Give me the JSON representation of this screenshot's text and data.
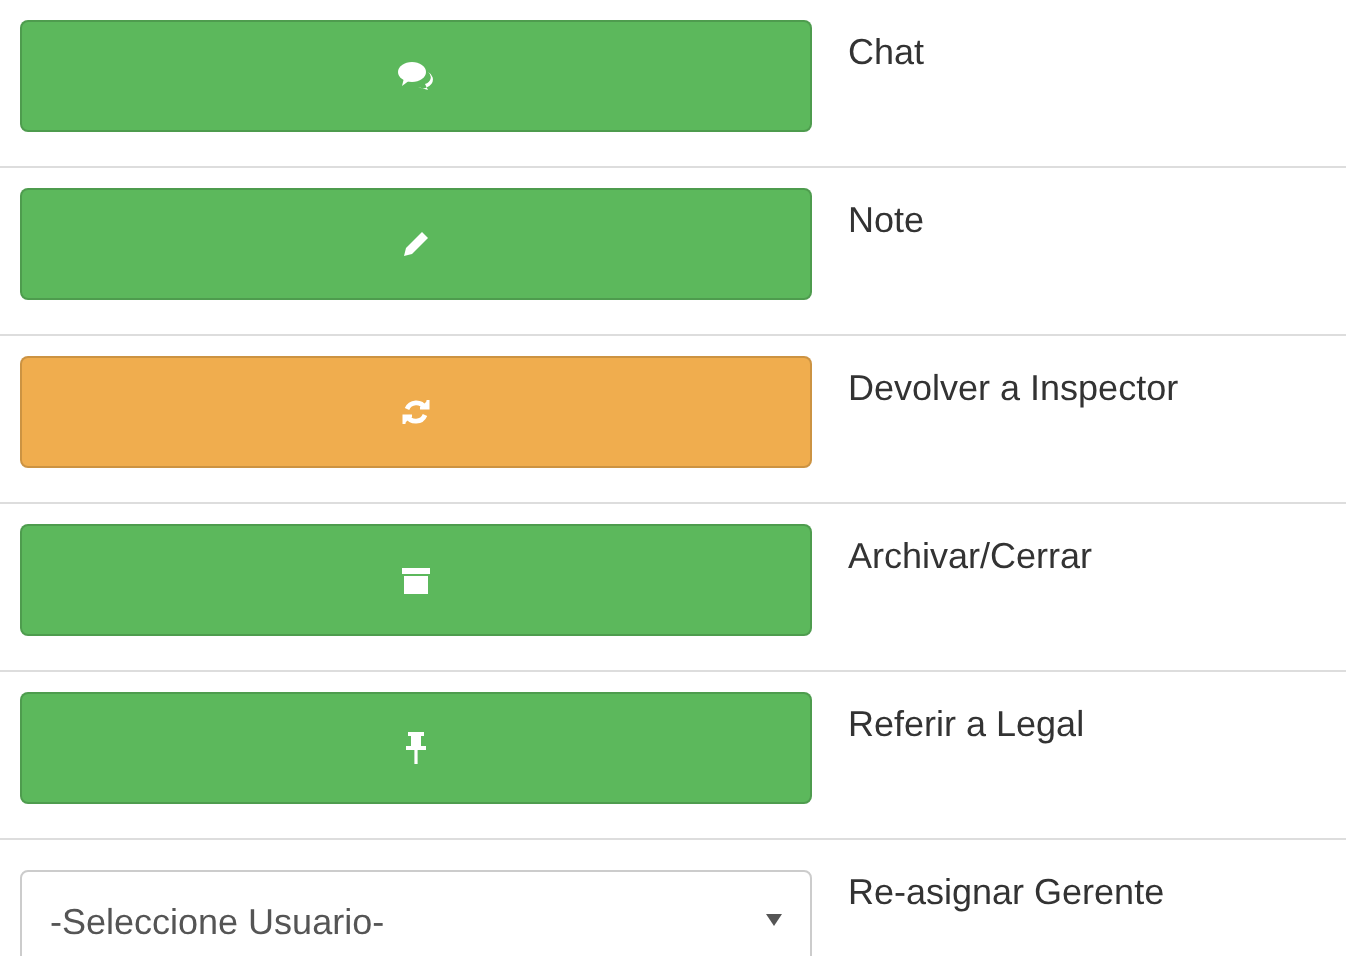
{
  "rows": [
    {
      "kind": "button",
      "color": "#5cb85c",
      "label": "Chat"
    },
    {
      "kind": "button",
      "color": "#5cb85c",
      "label": "Note"
    },
    {
      "kind": "button",
      "color": "#f0ad4e",
      "label": "Devolver a Inspector"
    },
    {
      "kind": "button",
      "color": "#5cb85c",
      "label": "Archivar/Cerrar"
    },
    {
      "kind": "button",
      "color": "#5cb85c",
      "label": "Referir a Legal"
    },
    {
      "kind": "select",
      "value": "-Seleccione Usuario-",
      "label": "Re-asignar Gerente"
    }
  ]
}
